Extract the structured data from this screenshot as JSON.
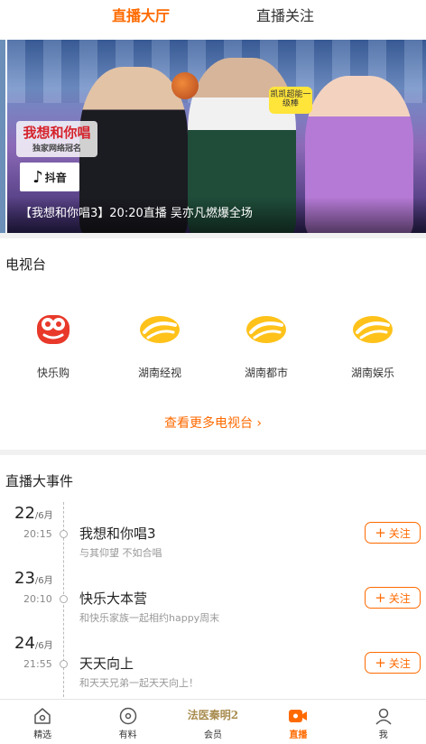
{
  "tabs": [
    {
      "label": "直播大厅",
      "active": true
    },
    {
      "label": "直播关注",
      "active": false
    }
  ],
  "banner": {
    "caption": "【我想和你唱3】20:20直播 吴亦凡燃爆全场",
    "show_logo": "我想和你唱",
    "show_logo_sub": "独家网络冠名",
    "sponsor": "抖音",
    "sticker": "凯凯超能一级棒"
  },
  "tv_section": {
    "title": "电视台",
    "channels": [
      {
        "label": "快乐购",
        "icon": "kuailegou-logo-icon"
      },
      {
        "label": "湖南经视",
        "icon": "mango-tv-logo-icon"
      },
      {
        "label": "湖南都市",
        "icon": "mango-tv-logo-icon"
      },
      {
        "label": "湖南娱乐",
        "icon": "mango-tv-logo-icon"
      }
    ],
    "more_label": "查看更多电视台 ›"
  },
  "events_section": {
    "title": "直播大事件",
    "events": [
      {
        "day": "22",
        "month": "/6月",
        "time": "20:15",
        "title": "我想和你唱3",
        "desc": "与其仰望 不如合唱",
        "follow_label": "关注"
      },
      {
        "day": "23",
        "month": "/6月",
        "time": "20:10",
        "title": "快乐大本营",
        "desc": "和快乐家族一起相约happy周末",
        "follow_label": "关注"
      },
      {
        "day": "24",
        "month": "/6月",
        "time": "21:55",
        "title": "天天向上",
        "desc": "和天天兄弟一起天天向上！",
        "follow_label": "关注"
      }
    ]
  },
  "bottom_nav": [
    {
      "label": "精选",
      "icon": "home-icon",
      "active": false
    },
    {
      "label": "有料",
      "icon": "disc-icon",
      "active": false
    },
    {
      "label": "会员",
      "icon": "member-logo-icon",
      "logo_text": "法医秦明2",
      "active": false
    },
    {
      "label": "直播",
      "icon": "video-camera-icon",
      "active": true
    },
    {
      "label": "我",
      "icon": "user-icon",
      "active": false
    }
  ],
  "colors": {
    "accent": "#ff6a00",
    "mango": "#ffc21a"
  }
}
